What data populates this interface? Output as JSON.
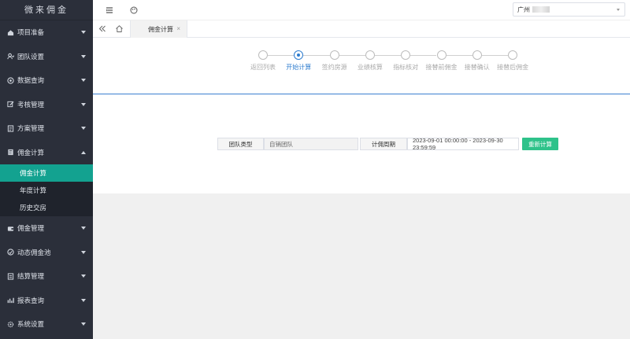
{
  "app": {
    "brand": "微来佣金"
  },
  "sidebar": {
    "items": [
      {
        "label": "项目准备",
        "icon": "home-icon"
      },
      {
        "label": "团队设置",
        "icon": "team-icon"
      },
      {
        "label": "数据查询",
        "icon": "search-circle-icon"
      },
      {
        "label": "考核管理",
        "icon": "edit-icon"
      },
      {
        "label": "方案管理",
        "icon": "document-icon"
      },
      {
        "label": "佣金计算",
        "icon": "calculator-icon"
      }
    ],
    "submenu": [
      {
        "label": "佣金计算"
      },
      {
        "label": "年度计算"
      },
      {
        "label": "历史交房"
      }
    ],
    "items_bottom": [
      {
        "label": "佣金管理",
        "icon": "wallet-icon"
      },
      {
        "label": "动态佣金池",
        "icon": "pool-icon"
      },
      {
        "label": "结算管理",
        "icon": "settlement-icon"
      },
      {
        "label": "报表查询",
        "icon": "bar-chart-icon"
      },
      {
        "label": "系统设置",
        "icon": "gear-icon"
      }
    ]
  },
  "topbar": {
    "city": "广州"
  },
  "tabs": [
    {
      "label": "佣金计算",
      "close": "×"
    }
  ],
  "steps": [
    {
      "label": "返回列表",
      "active": false
    },
    {
      "label": "开始计算",
      "active": true
    },
    {
      "label": "签约房源",
      "active": false
    },
    {
      "label": "业绩核算",
      "active": false
    },
    {
      "label": "指标核对",
      "active": false
    },
    {
      "label": "接替前佣金",
      "active": false
    },
    {
      "label": "接替确认",
      "active": false
    },
    {
      "label": "接替后佣金",
      "active": false
    }
  ],
  "form": {
    "team_type_label": "团队类型",
    "team_type_value": "自销团队",
    "period_label": "计佣周期",
    "period_value": "2023-09-01 00:00:00 - 2023-09-30 23:59:59",
    "submit_label": "重新计算"
  },
  "colors": {
    "sidebar_bg": "#2b2f3a",
    "active_green": "#13a290",
    "accent_blue": "#2d7ccf",
    "button_green": "#2ec28a"
  }
}
